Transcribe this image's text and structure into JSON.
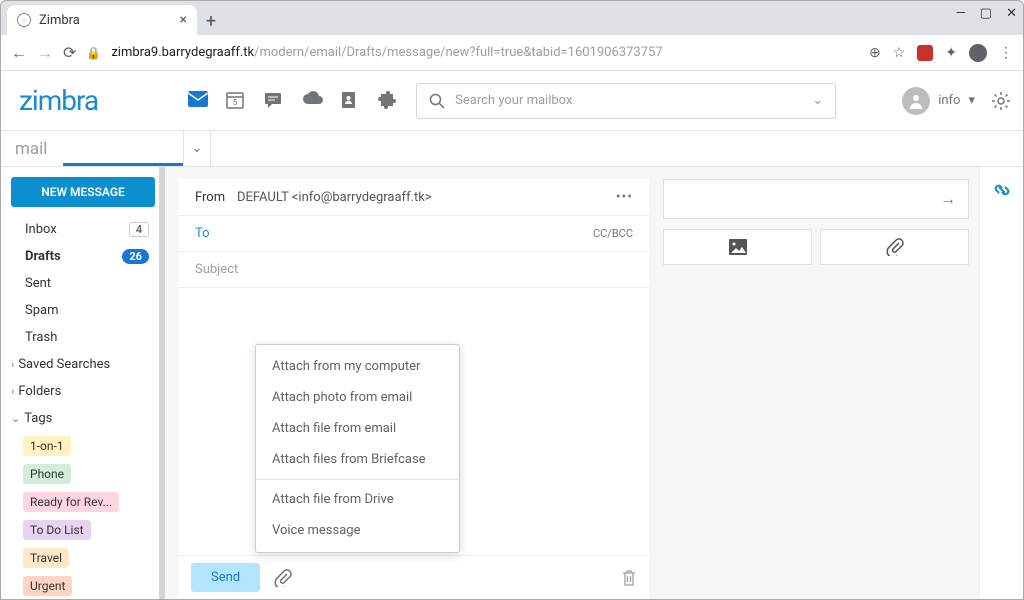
{
  "browser": {
    "tab_title": "Zimbra",
    "url_dark": "zimbra9.barrydegraaff.tk",
    "url_rest": "/modern/email/Drafts/message/new?full=true&tabid=1601906373757"
  },
  "header": {
    "logo": "zimbra",
    "search_placeholder": "Search your mailbox",
    "user_label": "info"
  },
  "mailbar": {
    "label": "mail"
  },
  "sidebar": {
    "new_message": "NEW MESSAGE",
    "inbox": "Inbox",
    "inbox_count": "4",
    "drafts": "Drafts",
    "drafts_count": "26",
    "sent": "Sent",
    "spam": "Spam",
    "trash": "Trash",
    "saved_searches": "Saved Searches",
    "folders": "Folders",
    "tags": "Tags",
    "tag_items": {
      "t0": "1-on-1",
      "t1": "Phone",
      "t2": "Ready for Rev...",
      "t3": "To Do List",
      "t4": "Travel",
      "t5": "Urgent"
    }
  },
  "compose": {
    "from_label": "From",
    "from_value": "DEFAULT <info@barrydegraaff.tk>",
    "to_label": "To",
    "ccbcc": "CC/BCC",
    "subject_placeholder": "Subject",
    "send": "Send"
  },
  "attach_menu": {
    "m0": "Attach from my computer",
    "m1": "Attach photo from email",
    "m2": "Attach file from email",
    "m3": "Attach files from Briefcase",
    "m4": "Attach file from Drive",
    "m5": "Voice message"
  }
}
